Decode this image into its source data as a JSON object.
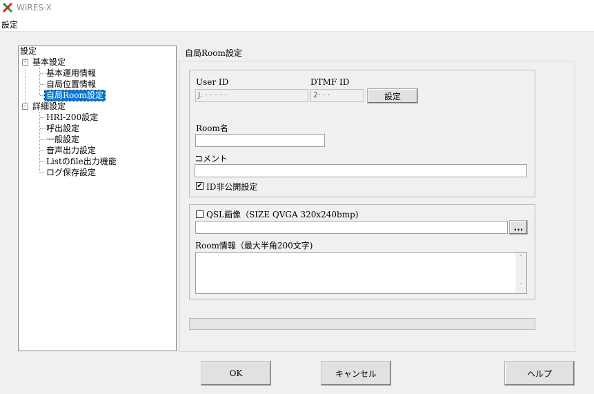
{
  "window": {
    "title": "WIRES-X"
  },
  "menu": {
    "settings": "設定"
  },
  "tree": {
    "root": "設定",
    "basic": "基本設定",
    "basic_items": [
      "基本運用情報",
      "自局位置情報",
      "自局Room設定"
    ],
    "advanced": "詳細設定",
    "advanced_items": [
      "HRI-200設定",
      "呼出設定",
      "一般設定",
      "音声出力設定",
      "Listのfile出力機能",
      "ログ保存設定"
    ],
    "box_expanded": "-"
  },
  "page": {
    "title": "自局Room設定",
    "user_id_label": "User ID",
    "user_id_value": "J. · · · · ·",
    "dtmf_id_label": "DTMF ID",
    "dtmf_id_value": "2· · ·",
    "set_button": "設定",
    "room_name_label": "Room名",
    "room_name_value": "",
    "comment_label": "コメント",
    "comment_value": "",
    "id_hidden_label": "ID非公開設定",
    "id_hidden_checked": "✔",
    "qsl_label": "QSL画像（SIZE QVGA 320x240bmp)",
    "qsl_checked": "",
    "qsl_path": "",
    "browse_button": "...",
    "room_info_label": "Room情報（最大半角200文字)",
    "room_info_value": "",
    "scroll_up": "˄",
    "scroll_down": "˅"
  },
  "footer": {
    "ok": "OK",
    "cancel": "キャンセル",
    "help": "ヘルプ"
  },
  "colors": {
    "selection": "#0078d7",
    "icon_green": "#1a9c3c",
    "icon_red": "#d9251c"
  }
}
